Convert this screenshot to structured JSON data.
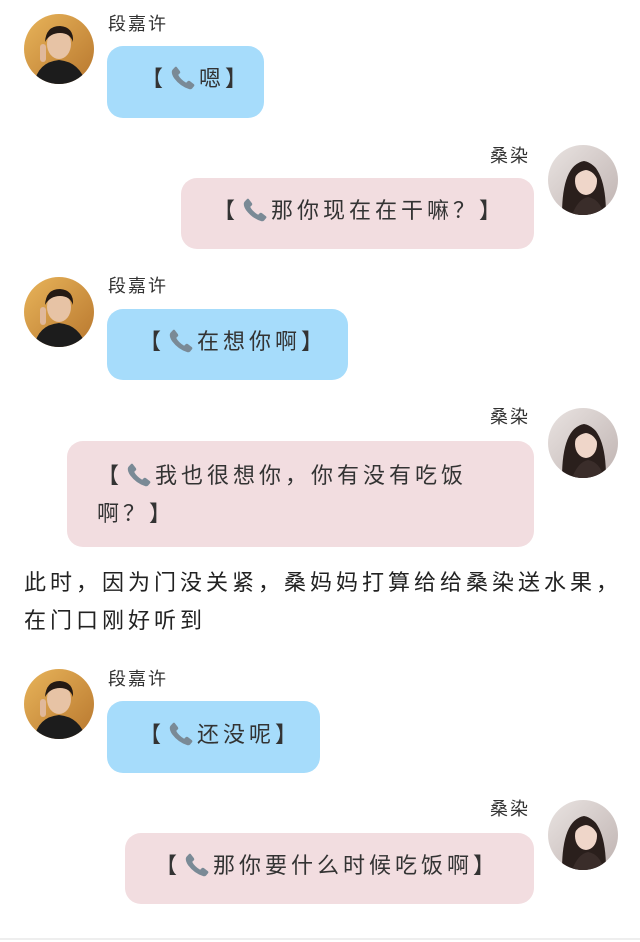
{
  "senders": {
    "male": "段嘉许",
    "female": "桑染"
  },
  "colors": {
    "male_bubble": "#a6dcfb",
    "female_bubble": "#f2dde0"
  },
  "messages": [
    {
      "sender": "段嘉许",
      "side": "left",
      "bracket_open": "【",
      "icon": "phone-icon",
      "text": "嗯",
      "bracket_close": "】"
    },
    {
      "sender": "桑染",
      "side": "right",
      "bracket_open": "【",
      "icon": "phone-icon",
      "text": "那你现在在干嘛？",
      "bracket_close": "】"
    },
    {
      "sender": "段嘉许",
      "side": "left",
      "bracket_open": "【",
      "icon": "phone-icon",
      "text": "在想你啊",
      "bracket_close": "】"
    },
    {
      "sender": "桑染",
      "side": "right",
      "bracket_open": "【",
      "icon": "phone-icon",
      "text": "我也很想你，你有没有吃饭啊？",
      "bracket_close": "】"
    }
  ],
  "narration": "此时，因为门没关紧，桑妈妈打算给给桑染送水果，在门口刚好听到",
  "messages_after": [
    {
      "sender": "段嘉许",
      "side": "left",
      "bracket_open": "【",
      "icon": "phone-icon",
      "text": "还没呢",
      "bracket_close": "】"
    },
    {
      "sender": "桑染",
      "side": "right",
      "bracket_open": "【",
      "icon": "phone-icon",
      "text": "那你要什么时候吃饭啊",
      "bracket_close": "】"
    }
  ]
}
